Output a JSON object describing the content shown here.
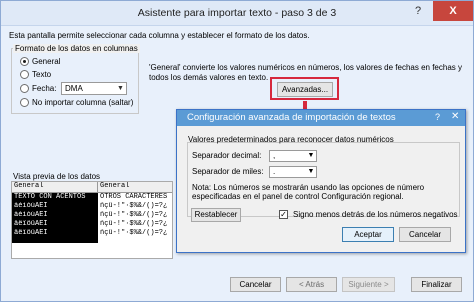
{
  "main_dialog": {
    "title": "Asistente para importar texto - paso 3 de 3",
    "help_label": "?",
    "close_label": "X",
    "intro": "Esta pantalla permite seleccionar cada columna y establecer el formato de los datos.",
    "format_group": {
      "title": "Formato de los datos en columnas",
      "options": [
        {
          "label": "General",
          "checked": true
        },
        {
          "label": "Texto",
          "checked": false
        },
        {
          "label": "Fecha:",
          "checked": false
        },
        {
          "label": "No importar columna (saltar)",
          "checked": false
        }
      ],
      "date_format": "DMA"
    },
    "description": "'General' convierte los valores numéricos en números, los valores de fechas en fechas y todos los demás valores en texto.",
    "advanced_button": "Avanzadas...",
    "preview": {
      "title": "Vista previa de los datos",
      "headers": [
        "General",
        "General"
      ],
      "col1_rows": [
        "TEXTO CON ACENTOS",
        "áéíóúÁÉÍ",
        "àèìòùÀÈÌ",
        "äëïöüÄËÏ",
        "âêîôûÂÊÎ"
      ],
      "col2_rows": [
        "OTROS CARACTERES",
        "ñçü-!\"·$%&/()=?¿",
        "ñçü-!\"·$%&/()=?¿",
        "ñçü-!\"·$%&/()=?¿",
        "ñçü-!\"·$%&/()=?¿"
      ]
    },
    "footer": {
      "cancel": "Cancelar",
      "back": "< Atrás",
      "next": "Siguiente >",
      "finish": "Finalizar"
    }
  },
  "advanced_dialog": {
    "title": "Configuración avanzada de importación de textos",
    "help_label": "?",
    "close_label": "✕",
    "group_title": "Valores predeterminados para reconocer datos numéricos",
    "decimal_label": "Separador decimal:",
    "decimal_value": ",",
    "thousands_label": "Separador de miles:",
    "thousands_value": ".",
    "note": "Nota: Los números se mostrarán usando las opciones de número especificadas en el panel de control Configuración regional.",
    "reset_button": "Restablecer",
    "trailing_minus_label": "Signo menos detrás de los números negativos",
    "trailing_minus_checked": true,
    "accept_button": "Aceptar",
    "cancel_button": "Cancelar"
  },
  "colors": {
    "highlight": "#d6283d",
    "sub_titlebar": "#5b9bd5",
    "close_button": "#c7463d"
  }
}
